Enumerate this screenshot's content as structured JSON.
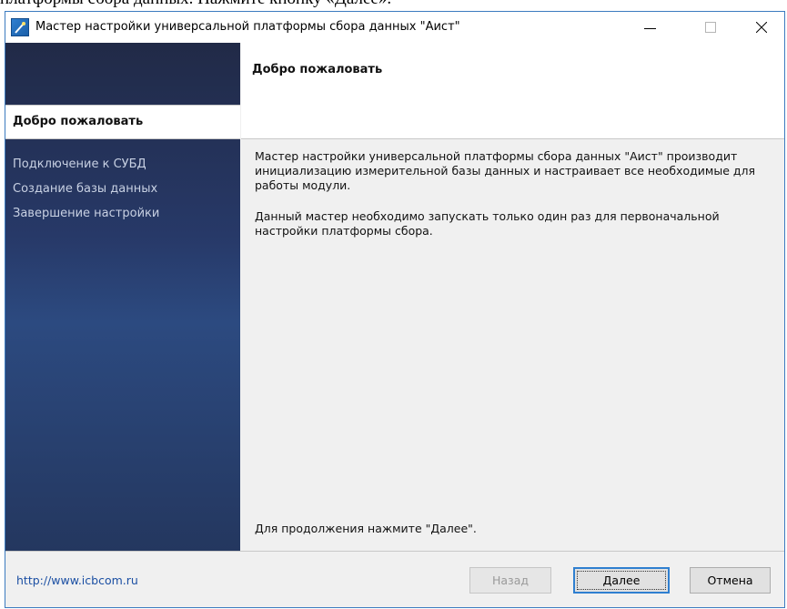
{
  "document_fragment": "платформы сбора данных. Нажмите кнопку «Далее».",
  "window": {
    "title": "Мастер настройки универсальной платформы сбора данных \"Аист\""
  },
  "sidebar": {
    "current_step": "Добро пожаловать",
    "items": [
      {
        "label": "Подключение к СУБД"
      },
      {
        "label": "Создание базы данных"
      },
      {
        "label": "Завершение настройки"
      }
    ]
  },
  "main": {
    "title": "Добро пожаловать",
    "paragraph1": "Мастер настройки универсальной платформы сбора данных \"Аист\" производит инициализацию измерительной базы данных и настраивает все необходимые для работы модули.",
    "paragraph2": "Данный мастер необходимо запускать только один раз для первоначальной настройки платформы сбора.",
    "footer_text": "Для продолжения нажмите \"Далее\"."
  },
  "footer": {
    "link": "http://www.icbcom.ru",
    "back_label": "Назад",
    "next_label": "Далее",
    "cancel_label": "Отмена"
  },
  "colors": {
    "sidebar_gradient_top": "#212a47",
    "sidebar_gradient_mid": "#2c4a80",
    "accent": "#2f7fd0",
    "link": "#1b4fa3"
  },
  "icons": {
    "app": "wizard-wand-icon",
    "minimize": "minimize-icon",
    "maximize": "maximize-icon",
    "close": "close-icon"
  }
}
